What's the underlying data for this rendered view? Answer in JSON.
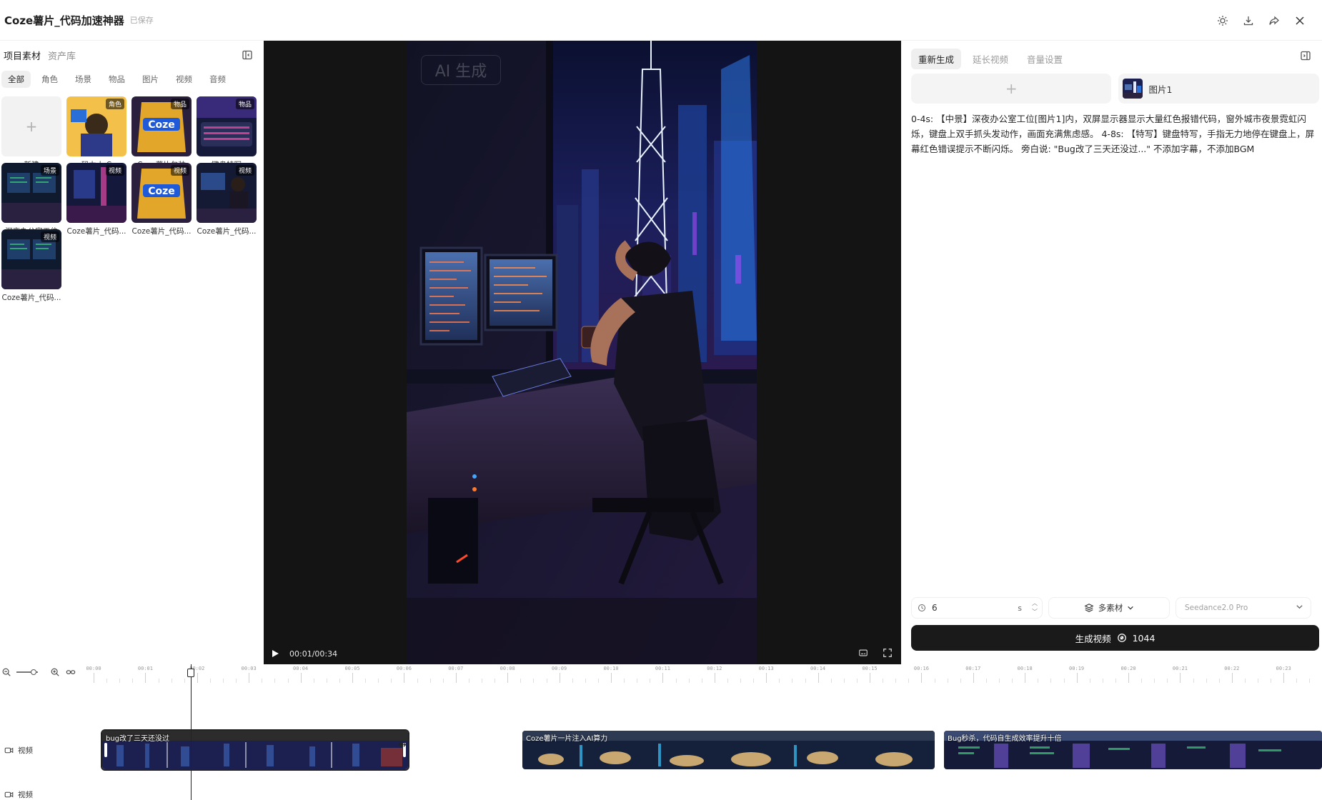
{
  "header": {
    "title": "Coze薯片_代码加速神器",
    "saved": "已保存",
    "icons": [
      "sun-icon",
      "download-icon",
      "share-icon",
      "close-icon"
    ]
  },
  "left_panel": {
    "tabs": [
      "项目素材",
      "资产库"
    ],
    "filters": [
      "全部",
      "角色",
      "场景",
      "物品",
      "图片",
      "视频",
      "音频"
    ],
    "new_label": "新建",
    "new_icon": "+",
    "assets": [
      {
        "caption": "码力小 C",
        "badge": "角色",
        "theme": "hero"
      },
      {
        "caption": "Coze薯片包装",
        "badge": "物品",
        "theme": "chips"
      },
      {
        "caption": "键盘特写",
        "badge": "物品",
        "theme": "keyboard"
      },
      {
        "caption": "深夜办公室工位",
        "badge": "场景",
        "theme": "office"
      },
      {
        "caption": "Coze薯片_代码...",
        "badge": "视频",
        "theme": "neon"
      },
      {
        "caption": "Coze薯片_代码...",
        "badge": "视频",
        "theme": "chips"
      },
      {
        "caption": "Coze薯片_代码...",
        "badge": "视频",
        "theme": "person"
      },
      {
        "caption": "Coze薯片_代码...",
        "badge": "视频",
        "theme": "office"
      }
    ]
  },
  "player": {
    "watermark": "AI 生成",
    "time": "00:01/00:34"
  },
  "right_panel": {
    "tabs": [
      "重新生成",
      "延长视频",
      "音量设置"
    ],
    "add_icon": "+",
    "ref_image_label": "图片1",
    "prompt": "0-4s: 【中景】深夜办公室工位[图片1]内，双屏显示器显示大量红色报错代码，窗外城市夜景霓虹闪烁，键盘上双手抓头发动作，画面充满焦虑感。 4-8s: 【特写】键盘特写，手指无力地停在键盘上，屏幕红色错误提示不断闪烁。 旁白说: \"Bug改了三天还没过...\" 不添加字幕，不添加BGM",
    "duration_value": "6",
    "duration_unit": "s",
    "material_label": "多素材",
    "model_label": "Seedance2.0 Pro",
    "generate_label": "生成视频",
    "credits": "1044",
    "colors": {
      "button_bg": "#1a1a1a",
      "tab_active_bg": "#efefef"
    }
  },
  "timeline": {
    "ticks": [
      "00:00",
      "00:01",
      "00:02",
      "00:03",
      "00:04",
      "00:05",
      "00:06",
      "00:07",
      "00:08",
      "00:09",
      "00:10",
      "00:11",
      "00:12",
      "00:13",
      "00:14",
      "00:15",
      "00:16",
      "00:17",
      "00:18",
      "00:19",
      "00:20",
      "00:21",
      "00:22",
      "00:23"
    ],
    "tracks": [
      "视频",
      "视频"
    ],
    "clips": [
      {
        "title": "bug改了三天还没过",
        "theme": "office"
      },
      {
        "title": "Coze薯片一片注入AI算力",
        "theme": "chips"
      },
      {
        "title": "Bug秒杀，代码自生成效率提升十倍",
        "theme": "code"
      }
    ]
  }
}
